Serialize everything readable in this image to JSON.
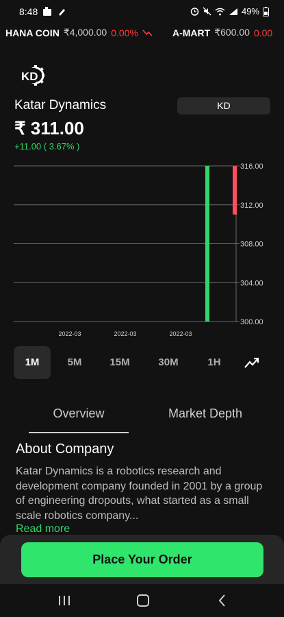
{
  "status_bar": {
    "time": "8:48",
    "battery": "49%"
  },
  "ticker": [
    {
      "name": "HANA COIN",
      "price": "₹4,000.00",
      "change": "0.00%",
      "direction": "down"
    },
    {
      "name": "A-MART",
      "price": "₹600.00",
      "change": "0.00"
    }
  ],
  "stock": {
    "name": "Katar Dynamics",
    "symbol": "KD",
    "logo_text": "KD",
    "price": "₹ 311.00",
    "change": "+11.00 ( 3.67% )"
  },
  "chart_data": {
    "type": "candlestick",
    "x_tick_labels": [
      "2022-03",
      "2022-03",
      "2022-03"
    ],
    "y_tick_labels": [
      "316.00",
      "312.00",
      "308.00",
      "304.00",
      "300.00"
    ],
    "ylim": [
      300,
      316
    ],
    "candles": [
      {
        "open": 300,
        "close": 316,
        "high": 316,
        "low": 300,
        "color": "#2fd866"
      },
      {
        "open": 316,
        "close": 311,
        "high": 316,
        "low": 311,
        "color": "#ff4d5e"
      }
    ],
    "grid": true
  },
  "timeframes": {
    "options": [
      "1M",
      "5M",
      "15M",
      "30M",
      "1H"
    ],
    "selected": "1M",
    "chart_style_icon": "line-chart-icon"
  },
  "tabs": {
    "overview": "Overview",
    "market_depth": "Market Depth",
    "selected": "Overview"
  },
  "about": {
    "title": "About Company",
    "text": "Katar Dynamics is a robotics research and development company founded in 2001 by a group of engineering dropouts, what started as a small scale robotics company...",
    "read_more": "Read more"
  },
  "order_button": "Place Your Order",
  "colors": {
    "accent_green": "#2fe56c",
    "positive": "#2fd866",
    "negative": "#ff3b3b",
    "background": "#121212"
  },
  "nav": {
    "icons": [
      "recent-apps-icon",
      "home-icon",
      "back-icon"
    ]
  }
}
